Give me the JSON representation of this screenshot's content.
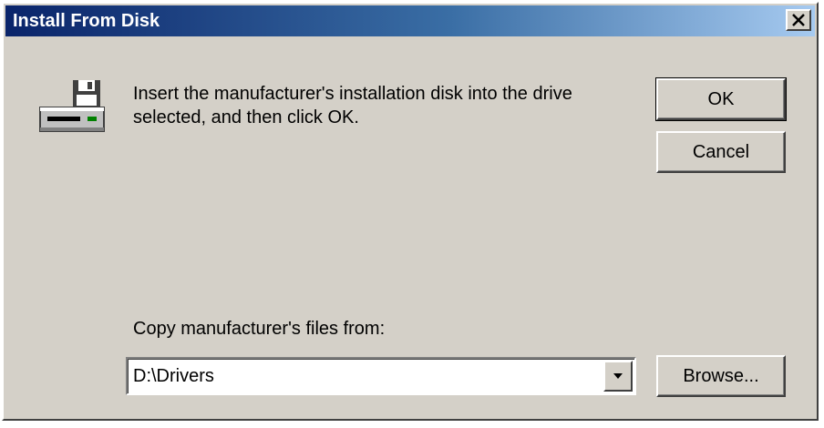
{
  "dialog": {
    "title": "Install From Disk",
    "message": "Insert the manufacturer's installation disk into the drive selected, and then click OK.",
    "icons": {
      "close": "close-icon",
      "disk": "floppy-drive-icon",
      "dropdown": "chevron-down-icon"
    }
  },
  "buttons": {
    "ok_label": "OK",
    "cancel_label": "Cancel",
    "browse_label": "Browse..."
  },
  "copy_from": {
    "label": "Copy manufacturer's files from:",
    "value": "D:\\Drivers"
  },
  "colors": {
    "titlebar_start": "#0a246a",
    "titlebar_end": "#a6caf0",
    "face": "#d4d0c8"
  }
}
